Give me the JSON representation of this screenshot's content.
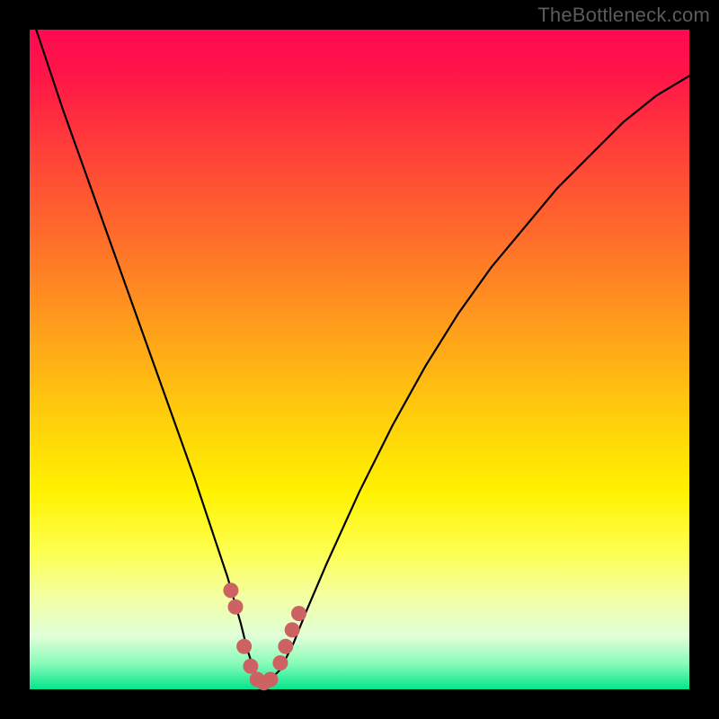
{
  "watermark": "TheBottleneck.com",
  "chart_data": {
    "type": "line",
    "title": "",
    "xlabel": "",
    "ylabel": "",
    "xlim": [
      0,
      100
    ],
    "ylim": [
      0,
      100
    ],
    "grid": false,
    "series": [
      {
        "name": "curve",
        "color": "#000000",
        "x": [
          1,
          5,
          10,
          15,
          20,
          25,
          28,
          30,
          32,
          33,
          34,
          35,
          36,
          38,
          40,
          42,
          45,
          50,
          55,
          60,
          65,
          70,
          75,
          80,
          85,
          90,
          95,
          100
        ],
        "y": [
          100,
          88,
          74,
          60,
          46,
          32,
          23,
          17,
          10,
          6,
          3,
          1,
          1,
          3,
          7,
          12,
          19,
          30,
          40,
          49,
          57,
          64,
          70,
          76,
          81,
          86,
          90,
          93
        ]
      },
      {
        "name": "markers",
        "type": "scatter",
        "color": "#cc6262",
        "x": [
          30.5,
          31.2,
          32.5,
          33.5,
          34.5,
          35.5,
          36.5,
          38.0,
          38.8,
          39.8,
          40.8
        ],
        "y": [
          15.0,
          12.5,
          6.5,
          3.5,
          1.5,
          1.0,
          1.5,
          4.0,
          6.5,
          9.0,
          11.5
        ]
      }
    ]
  }
}
